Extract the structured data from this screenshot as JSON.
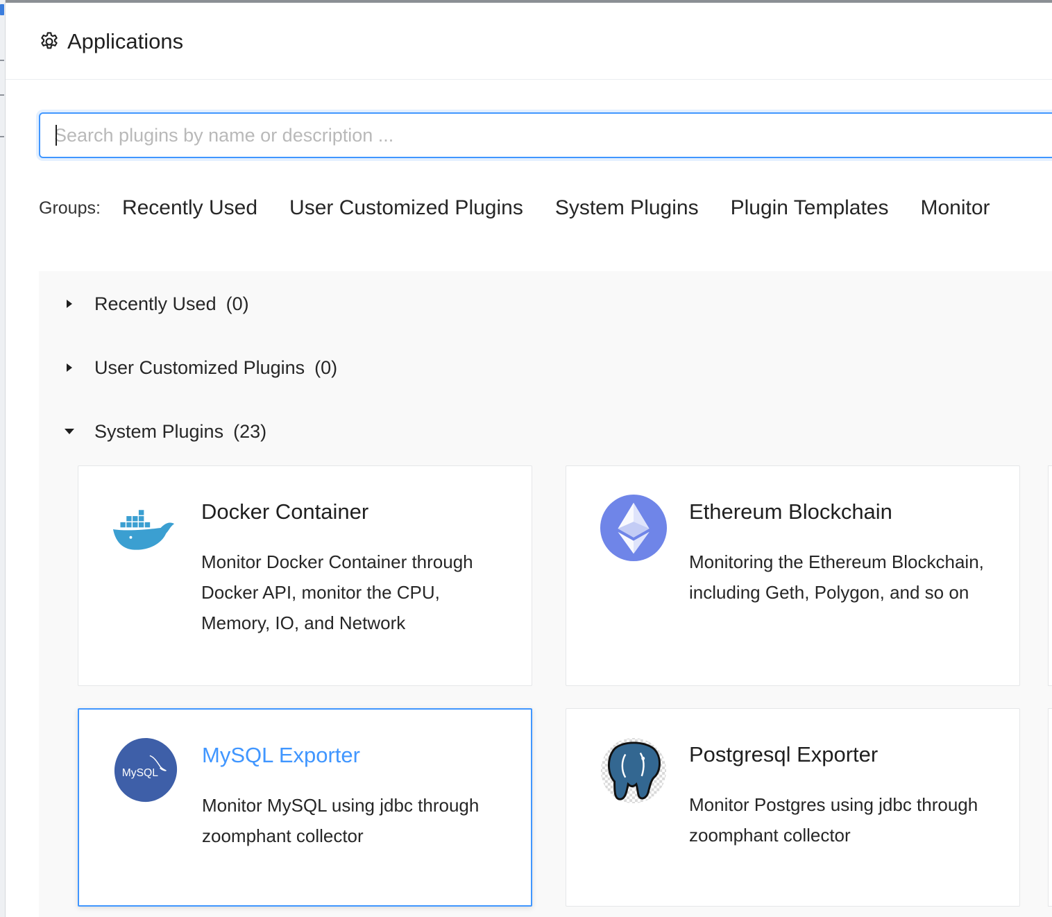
{
  "header": {
    "title": "Applications",
    "icon": "gear-icon"
  },
  "search": {
    "placeholder": "Search plugins by name or description ...",
    "value": ""
  },
  "groups": {
    "label": "Groups:",
    "tags": [
      "Recently Used",
      "User Customized Plugins",
      "System Plugins",
      "Plugin Templates",
      "Monitor"
    ]
  },
  "sections": [
    {
      "title": "Recently Used",
      "count": "(0)",
      "expanded": false
    },
    {
      "title": "User Customized Plugins",
      "count": "(0)",
      "expanded": false
    },
    {
      "title": "System Plugins",
      "count": "(23)",
      "expanded": true
    }
  ],
  "cards": [
    {
      "title": "Docker Container",
      "description": "Monitor Docker Container through Docker API, monitor the CPU, Memory, IO, and Network",
      "icon": "docker-icon",
      "selected": false
    },
    {
      "title": "Ethereum Blockchain",
      "description": "Monitoring the Ethereum Blockchain, including Geth, Polygon, and so on",
      "icon": "ethereum-icon",
      "selected": false
    },
    {
      "title": "MySQL Exporter",
      "description": "Monitor MySQL using jdbc through zoomphant collector",
      "icon": "mysql-icon",
      "logo_text": "MySQL",
      "selected": true
    },
    {
      "title": "Postgresql Exporter",
      "description": "Monitor Postgres using jdbc through zoomphant collector",
      "icon": "postgresql-icon",
      "selected": false
    }
  ],
  "colors": {
    "accent": "#4096ff",
    "docker": "#3b9fd1",
    "ethereum": "#6f85e8",
    "mysql": "#3e5fa8",
    "postgresql": "#336791"
  }
}
